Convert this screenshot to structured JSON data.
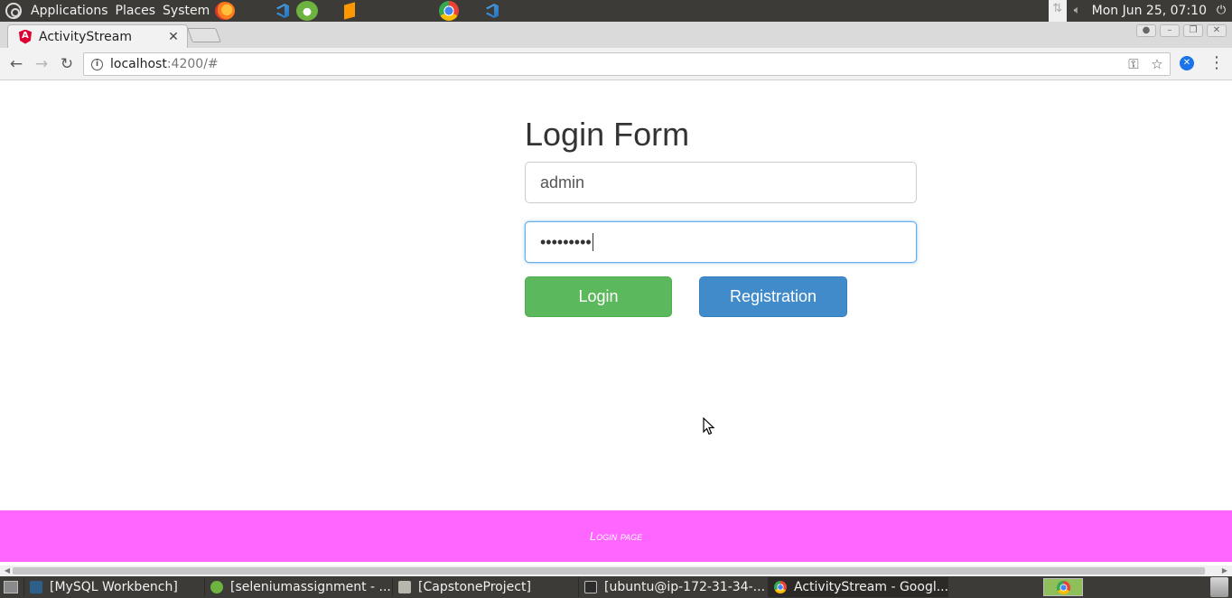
{
  "top_panel": {
    "menus": [
      "Applications",
      "Places",
      "System"
    ],
    "clock": "Mon Jun 25, 07:10",
    "launchers": [
      "firefox-icon",
      "vscode-icon",
      "spring-icon",
      "sublime-icon",
      "chrome-icon",
      "vscode-icon"
    ]
  },
  "browser": {
    "tab_title": "ActivityStream",
    "url_host": "localhost",
    "url_rest": ":4200/#"
  },
  "page": {
    "title": "Login Form",
    "username_value": "admin",
    "password_value": "•••••••••",
    "login_label": "Login",
    "registration_label": "Registration",
    "footer_text": "Login page"
  },
  "taskbar": {
    "tasks": [
      {
        "label": "[MySQL Workbench]",
        "icon": "mysql-icon"
      },
      {
        "label": "[seleniumassignment - ...",
        "icon": "eclipse-icon"
      },
      {
        "label": "[CapstoneProject]",
        "icon": "folder-icon"
      },
      {
        "label": "[ubuntu@ip-172-31-34-...",
        "icon": "terminal-icon"
      },
      {
        "label": "ActivityStream - Googl...",
        "icon": "chrome-icon"
      }
    ]
  },
  "colors": {
    "login_button": "#5cb85c",
    "registration_button": "#428bca",
    "footer": "#ff66ff",
    "panel": "#3c3b37"
  }
}
